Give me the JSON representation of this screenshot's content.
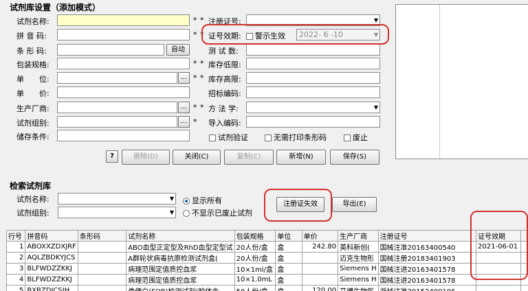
{
  "settings": {
    "title": "试剂库设置（添加模式）",
    "left_fields": [
      {
        "label": "试剂名称:",
        "value": "",
        "star": "*"
      },
      {
        "label": "拼 音 码:",
        "value": "",
        "star": "*"
      },
      {
        "label": "条 形 码:",
        "value": "",
        "star": ""
      },
      {
        "label": "包装规格:",
        "value": "",
        "star": "*"
      },
      {
        "label": "单　　位:",
        "value": "",
        "star": "*"
      },
      {
        "label": "单　　价:",
        "value": "",
        "star": ""
      },
      {
        "label": "生产厂商:",
        "value": "",
        "star": "*"
      },
      {
        "label": "试剂组别:",
        "value": "",
        "star": "*"
      },
      {
        "label": "储存条件:",
        "value": "",
        "star": ""
      }
    ],
    "auto_button": "自动",
    "ellipsis": "...",
    "right_fields": [
      {
        "label": "注册证号:",
        "value": "",
        "star": "*"
      },
      {
        "label": "证号效期:",
        "value": "",
        "star": "*"
      },
      {
        "label": "测 试 数:",
        "value": "",
        "star": ""
      },
      {
        "label": "库存低限:",
        "value": "",
        "star": "*"
      },
      {
        "label": "库存高限:",
        "value": "",
        "star": "*"
      },
      {
        "label": "招标编码:",
        "value": "",
        "star": ""
      },
      {
        "label": "方 法 学:",
        "value": "",
        "star": "*"
      },
      {
        "label": "导入编码:",
        "value": "",
        "star": ""
      }
    ],
    "warn_checkbox": "警示生效",
    "expiry_date": "2022- 6 -10",
    "checkboxes": [
      "试剂验证",
      "无需打印条形码",
      "废止"
    ],
    "help_button": "?",
    "buttons": {
      "delete": "删除(D)",
      "close": "关闭(C)",
      "copy": "复制(C)",
      "add": "新增(N)",
      "save": "保存(S)"
    }
  },
  "search": {
    "title": "检索试剂库",
    "name_label": "试剂名称:",
    "group_label": "试剂组别:",
    "radio_all": "显示所有",
    "radio_hide": "不显示已废止试剂",
    "expire_button": "注册证失效",
    "export_button": "导出(E)"
  },
  "table": {
    "columns": [
      "行号",
      "拼音码",
      "条形码",
      "试剂名称",
      "包装规格",
      "单位",
      "单价",
      "生产厂商",
      "注册证号",
      "证号效期"
    ],
    "rows": [
      [
        "1",
        "ABOXXZDXJRF",
        "",
        "ABO血型正定型及RhD血型定型试",
        "20人份/盒",
        "盒",
        "242.80",
        "英科新创(",
        "国械注准20163400540",
        "2021-06-01"
      ],
      [
        "2",
        "AQLZBDKYJCS",
        "",
        "A群轮状病毒抗原检测试剂盒(",
        "20人份/盒",
        "盒",
        "",
        "迈克生物形",
        "国械注册20183401903",
        ""
      ],
      [
        "3",
        "BLFWDZZKKJ",
        "",
        "病理范围定值质控血浆",
        "10×1ml/盒",
        "盒",
        "",
        "Siemens H",
        "国械注进20163401578",
        ""
      ],
      [
        "4",
        "BLFWDZZKKJ",
        "",
        "病理范围定值质控血浆",
        "10×1.0mL",
        "盒",
        "",
        "Siemens H",
        "国械注进20163401578",
        ""
      ],
      [
        "5",
        "BXBZDJCSJH",
        "",
        "粪便白(FOB)检测试剂(胶体金",
        "50人份/盒",
        "盒",
        "120.00",
        "艾博生物医",
        "浙械注准20152400196",
        ""
      ]
    ]
  }
}
